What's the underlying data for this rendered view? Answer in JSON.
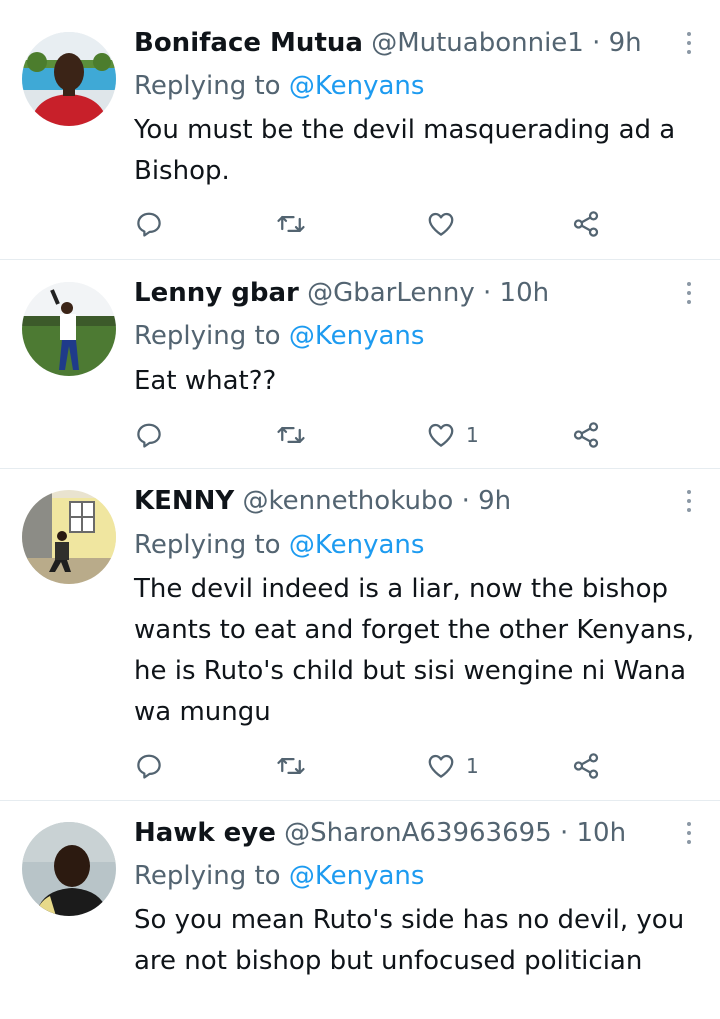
{
  "replying_label": "Replying to",
  "tweets": [
    {
      "name": "Boniface Mutua",
      "handle": "@Mutuabonnie1",
      "dot": "·",
      "time": "9h",
      "reply_to": "@Kenyans",
      "text": "You must be the devil masquerading ad a Bishop.",
      "like_count": ""
    },
    {
      "name": "Lenny gbar",
      "handle": "@GbarLenny",
      "dot": "·",
      "time": "10h",
      "reply_to": "@Kenyans",
      "text": "Eat what??",
      "like_count": "1"
    },
    {
      "name": "KENNY",
      "handle": "@kennethokubo",
      "dot": "·",
      "time": "9h",
      "reply_to": "@Kenyans",
      "text": "The devil indeed is a liar, now the bishop wants to eat and forget the other Kenyans, he is Ruto's child but sisi wengine ni Wana wa mungu",
      "like_count": "1"
    },
    {
      "name": "Hawk eye",
      "handle": "@SharonA63963695",
      "dot": "·",
      "time": "10h",
      "reply_to": "@Kenyans",
      "text": "So you mean Ruto's side has no devil, you are not bishop but unfocused politician",
      "like_count": ""
    }
  ]
}
